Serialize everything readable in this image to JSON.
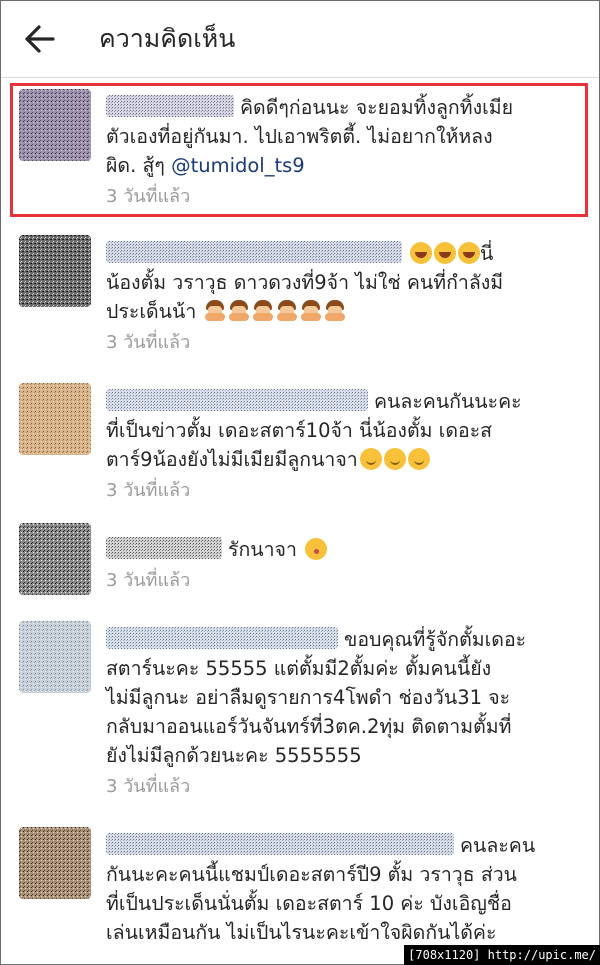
{
  "header": {
    "title": "ความคิดเห็น",
    "back_icon": "arrow-left-icon"
  },
  "colors": {
    "highlight": "#e8323a",
    "mention": "#1a3a7a",
    "muted": "#9a9a9a"
  },
  "comments": [
    {
      "lines": [
        "คิดดีๆก่อนนะ จะยอมทิ้งลูกทิ้งเมีย",
        "ตัวเองที่อยู่กันมา. ไปเอาพริตตี้. ไม่อยากให้หลง",
        "ผิด. สู้ๆ "
      ],
      "mention": "@tumidol_ts9",
      "time": "3 วันที่แล้ว",
      "highlighted": true
    },
    {
      "lines": [
        "นี่",
        "น้องตั้ม วราวุธ ดาวดวงที่9จ้า ไม่ใช่ คนที่กำลังมี",
        "ประเด็นน้า"
      ],
      "time": "3 วันที่แล้ว"
    },
    {
      "lines": [
        "คนละคนกันนะคะ",
        "ที่เป็นข่าวตั้ม เดอะสตาร์10จ้า นี่น้องตั้ม เดอะส",
        "ตาร์9น้องยังไม่มีเมียมีลูกนาจา"
      ],
      "time": "3 วันที่แล้ว"
    },
    {
      "lines": [
        "รักนาจา"
      ],
      "time": "3 วันที่แล้ว"
    },
    {
      "lines": [
        "ขอบคุณที่รู้จักตั้มเดอะ",
        "สตาร์นะคะ 55555 แต่ตั้มมี2ตั้มค่ะ ตั้มคนนี้ยัง",
        "ไม่มีลูกนะ อย่าลืมดูรายการ4โพดำ ช่องวัน31 จะ",
        "กลับมาออนแอร์วันจันทร์ที่3ตค.2ทุ่ม ติดตามตั้มที่",
        "ยังไม่มีลูกด้วยนะคะ 5555555"
      ],
      "time": "3 วันที่แล้ว"
    },
    {
      "lines": [
        "คนละคน",
        "กันนะคะคนนี้แชมป์เดอะสตาร์ปี9 ตั้ม วราวุธ ส่วน",
        "ที่เป็นประเด็นนั่นตั้ม เดอะสตาร์ 10 ค่ะ บังเอิญชื่อ",
        "เล่นเหมือนกัน ไม่เป็นไรนะคะเข้าใจผิดกันได้ค่ะ"
      ]
    }
  ],
  "watermark": "[708x1120] http://upic.me/"
}
